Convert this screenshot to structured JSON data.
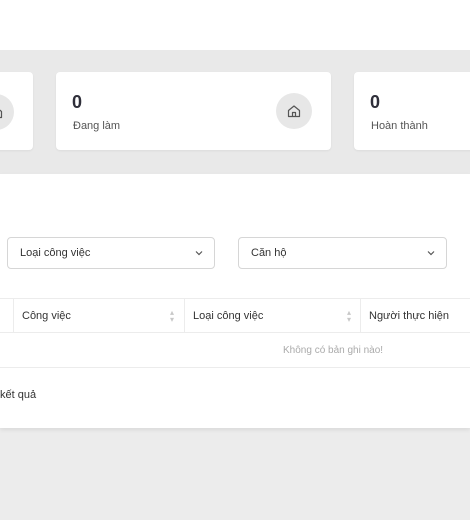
{
  "stats": [
    {
      "value": "0",
      "label": "Đang làm",
      "icon": "home-icon"
    },
    {
      "value": "0",
      "label": "Hoàn thành",
      "icon": "home-icon"
    }
  ],
  "filters": {
    "job_type": {
      "value": "Loại công việc",
      "icon": "chevron-down-icon"
    },
    "apartment": {
      "value": "Căn hộ",
      "icon": "chevron-down-icon"
    }
  },
  "table": {
    "columns": [
      "Công việc",
      "Loại công việc",
      "Người thực hiện"
    ],
    "empty_text": "Không có bản ghi nào!"
  },
  "footer": {
    "result_text": "kết quả"
  }
}
